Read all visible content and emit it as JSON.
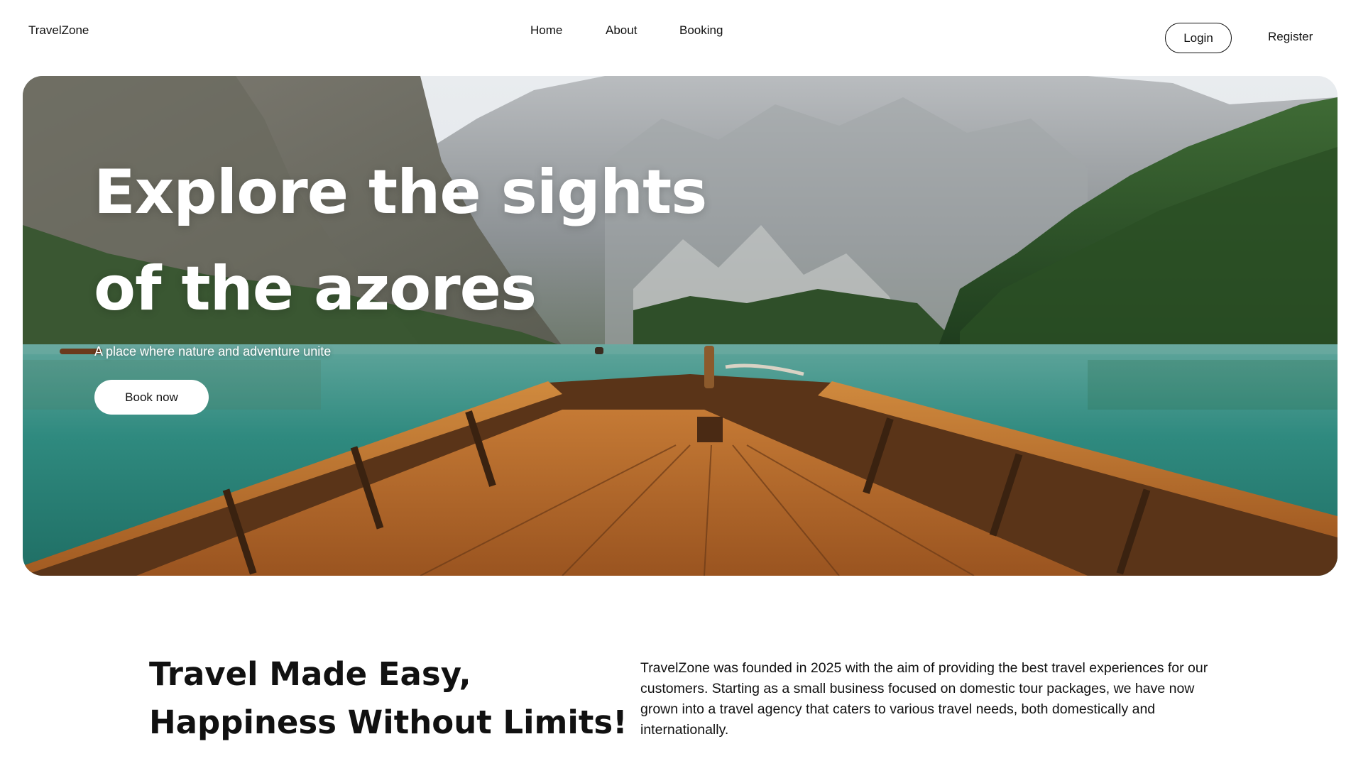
{
  "header": {
    "brand": "TravelZone",
    "nav": {
      "home": "Home",
      "about": "About",
      "booking": "Booking"
    },
    "login_label": "Login",
    "register_label": "Register"
  },
  "hero": {
    "title_line1": "Explore the sights",
    "title_line2": "of the azores",
    "subtitle": "A place where nature and adventure unite",
    "cta_label": "Book now"
  },
  "about": {
    "heading_line1": "Travel Made Easy,",
    "heading_line2": "Happiness Without Limits!",
    "body": "TravelZone was founded in 2025 with the aim of providing the best travel experiences for our customers. Starting as a small business focused on domestic tour packages, we have now grown into a travel agency that caters to various travel needs, both domestically and internationally."
  },
  "colors": {
    "text": "#111111",
    "background": "#ffffff",
    "lake": "#2f8a7f",
    "boat_wood": "#b8692a"
  }
}
